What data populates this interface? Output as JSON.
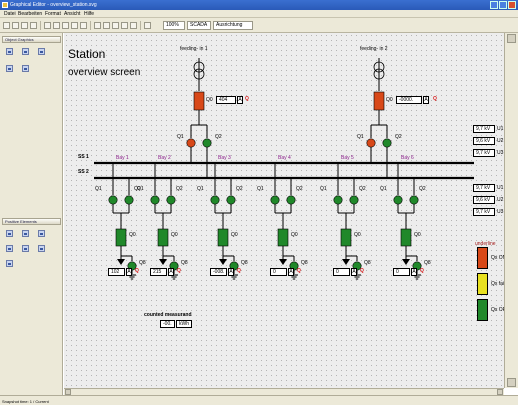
{
  "window": {
    "title": "Graphical Editor - overview_station.svg"
  },
  "menu": [
    "Datei",
    "Bearbeiten",
    "Format",
    "Ansicht",
    "Hilfe"
  ],
  "toolbar": {
    "zoom": "100%",
    "layer": "SCADA",
    "view": "Ausrichtung"
  },
  "left_panel": {
    "section1_title": "Object Graphics",
    "section2_title": "Positive Elements"
  },
  "canvas": {
    "title_line1": "Station",
    "title_line2": "overview screen",
    "feeder1_label": "feeding- in 1",
    "feeder2_label": "feeding- in 2",
    "q0_label": "Q0",
    "q1_label": "Q1",
    "q2_label": "Q2",
    "q8_label": "Q8",
    "feeder1_measurement": "404",
    "feeder2_measurement": "-0000.",
    "unit_amp": "A",
    "quality_flag": "Q",
    "ss1_label": "SS 1",
    "ss2_label": "SS 2",
    "bays": [
      "Bay 1",
      "Bay 2",
      "Bay 3",
      "Bay 4",
      "Bay 5",
      "Bay 6"
    ],
    "bay_measurements": [
      "102",
      "215",
      "-008.",
      "0",
      "0",
      "0"
    ],
    "counted_label": "counted measurand",
    "counted_value": "-00.",
    "counted_unit": "kWh",
    "voltage_groups": [
      {
        "values": [
          "9,7 kV",
          "9,6 kV",
          "9,7 kV"
        ],
        "units": [
          "U1",
          "U2",
          "U3"
        ]
      },
      {
        "values": [
          "9,7 kV",
          "9,6 kV",
          "9,7 kV"
        ],
        "units": [
          "U1",
          "U2",
          "U3"
        ]
      }
    ],
    "legend_title": "underline",
    "legend": [
      {
        "label": "Qx ON",
        "color": "#d84818"
      },
      {
        "label": "Qx failure",
        "color": "#e8e020"
      },
      {
        "label": "Qx OFF",
        "color": "#20882a"
      }
    ]
  },
  "colors": {
    "switch_on": "#d84818",
    "switch_off": "#20882a",
    "busbar": "#000000",
    "wire": "#000000"
  },
  "statusbar": {
    "text": "Snapshot time: 1 / Current"
  }
}
